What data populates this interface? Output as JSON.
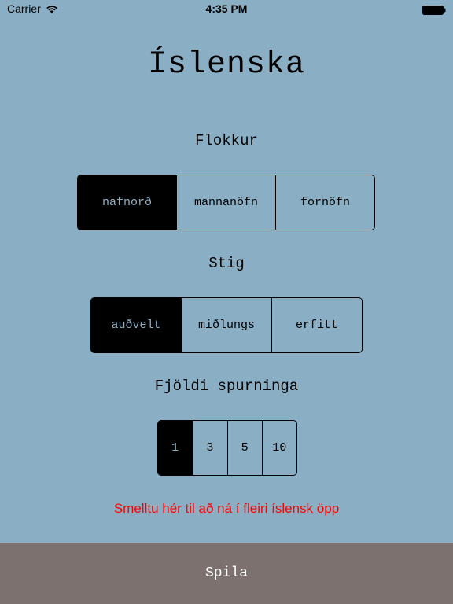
{
  "status_bar": {
    "carrier": "Carrier",
    "time": "4:35 PM",
    "icons": [
      "wifi-icon",
      "battery-icon"
    ]
  },
  "app": {
    "title": "Íslenska"
  },
  "category": {
    "label": "Flokkur",
    "options": [
      "nafnorð",
      "mannanöfn",
      "fornöfn"
    ],
    "selected": "nafnorð"
  },
  "level": {
    "label": "Stig",
    "options": [
      "auðvelt",
      "miðlungs",
      "erfitt"
    ],
    "selected": "auðvelt"
  },
  "question_count": {
    "label": "Fjöldi spurninga",
    "options": [
      "1",
      "3",
      "5",
      "10"
    ],
    "selected": "1"
  },
  "more_apps_link": "Smelltu hér til að ná í fleiri íslensk öpp",
  "play_button": "Spila",
  "colors": {
    "background": "#8aafc5",
    "selected_segment": "#000000",
    "link": "#ff0000",
    "play_bar": "#7d716f"
  }
}
